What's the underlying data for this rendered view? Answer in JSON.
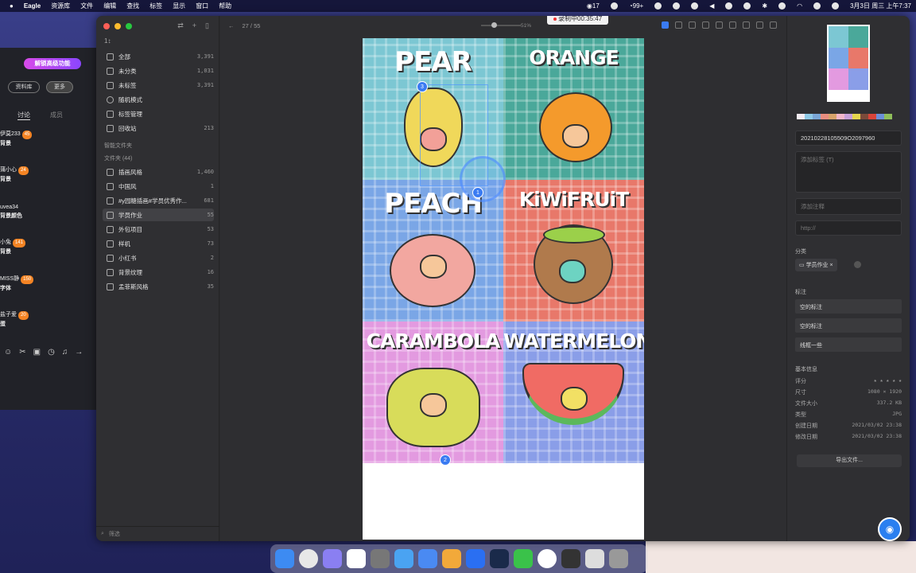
{
  "menubar": {
    "items": [
      "Eagle",
      "资源库",
      "文件",
      "编辑",
      "查找",
      "标签",
      "显示",
      "窗口",
      "帮助"
    ],
    "status": {
      "c17": "17",
      "wechat": "99+",
      "datetime": "3月3日 周三 上午7:37"
    }
  },
  "bg_window": {
    "promo": "解锁高级功能",
    "pill_library": "资料库",
    "pill_more": "更多",
    "tab_discussion": "讨论",
    "tab_members": "成员",
    "chats": [
      {
        "user": "伊莫233",
        "badge": "45",
        "msg": "背景"
      },
      {
        "user": "蒲小心",
        "badge": "24",
        "msg": "背景"
      },
      {
        "user": "uvea34",
        "badge": "",
        "msg": "背景颜色"
      },
      {
        "user": "小兔",
        "badge": "141",
        "msg": "背景"
      },
      {
        "user": "MISS静",
        "badge": "150",
        "msg": "字体"
      },
      {
        "user": "盐子爱",
        "badge": "20",
        "msg": "蛋"
      }
    ]
  },
  "sidebar": {
    "sort": "1↕",
    "nav": [
      {
        "label": "全部",
        "count": "3,391"
      },
      {
        "label": "未分类",
        "count": "1,031"
      },
      {
        "label": "未标签",
        "count": "3,391"
      },
      {
        "label": "随机模式",
        "count": ""
      },
      {
        "label": "标签管理",
        "count": ""
      },
      {
        "label": "回收站",
        "count": "213"
      }
    ],
    "smart_header": "智能文件夹",
    "folders_header": "文件夹 (44)",
    "folders": [
      {
        "label": "插画风格",
        "count": "1,460"
      },
      {
        "label": "中国风",
        "count": "1"
      },
      {
        "label": "#y园糖插画#学员优秀作...",
        "count": "681"
      },
      {
        "label": "学员作业",
        "count": "55"
      },
      {
        "label": "外包项目",
        "count": "53"
      },
      {
        "label": "样机",
        "count": "73"
      },
      {
        "label": "小红书",
        "count": "2"
      },
      {
        "label": "背景纹理",
        "count": "16"
      },
      {
        "label": "孟菲斯风格",
        "count": "35"
      }
    ],
    "filter_placeholder": "筛选"
  },
  "viewer": {
    "page_counter": "27 / 55",
    "recording": "录制中00:35:47",
    "zoom": "51%",
    "zoom_fraction": 0.3,
    "fruits": [
      "PEAR",
      "ORANGE",
      "PEACH",
      "KiWiFRUiT",
      "CARAMBOLA",
      "WATERMELON"
    ],
    "marker1": "1",
    "marker2": "2",
    "marker3": "3"
  },
  "inspector": {
    "filename": "20210228105509O2097960",
    "tag_placeholder": "添加标签 (T)",
    "note_placeholder": "添加注释",
    "url_placeholder": "http://",
    "category_label": "分类",
    "category_chip": "学员作业",
    "annotation_label": "标注",
    "annotations": [
      "空的标注",
      "空的标注",
      "线框一些"
    ],
    "info_label": "基本信息",
    "info": [
      {
        "k": "评分",
        "v": "★ ★ ★ ★ ★"
      },
      {
        "k": "尺寸",
        "v": "1080 × 1920"
      },
      {
        "k": "文件大小",
        "v": "337.2 KB"
      },
      {
        "k": "类型",
        "v": "JPG"
      },
      {
        "k": "创建日期",
        "v": "2021/03/02 23:38"
      },
      {
        "k": "修改日期",
        "v": "2021/03/02 23:38"
      }
    ],
    "export": "导出文件...",
    "swatches": [
      "#f4ecf2",
      "#8fc9e6",
      "#7aa6d6",
      "#e88d7f",
      "#d7a36a",
      "#f2b6c9",
      "#c8a0d8",
      "#e6d64e",
      "#7b4a3a",
      "#d8443a",
      "#6b8fd8",
      "#8fbe5a"
    ]
  },
  "colors": {
    "accent": "#3a7bf2",
    "pear_bg": "#7cc7d3",
    "orange_bg": "#4aa89a",
    "peach_bg": "#7aa6e6",
    "kiwi_bg": "#e8786a",
    "carambola_bg": "#e39ae0",
    "watermelon_bg": "#8a9ee8"
  }
}
